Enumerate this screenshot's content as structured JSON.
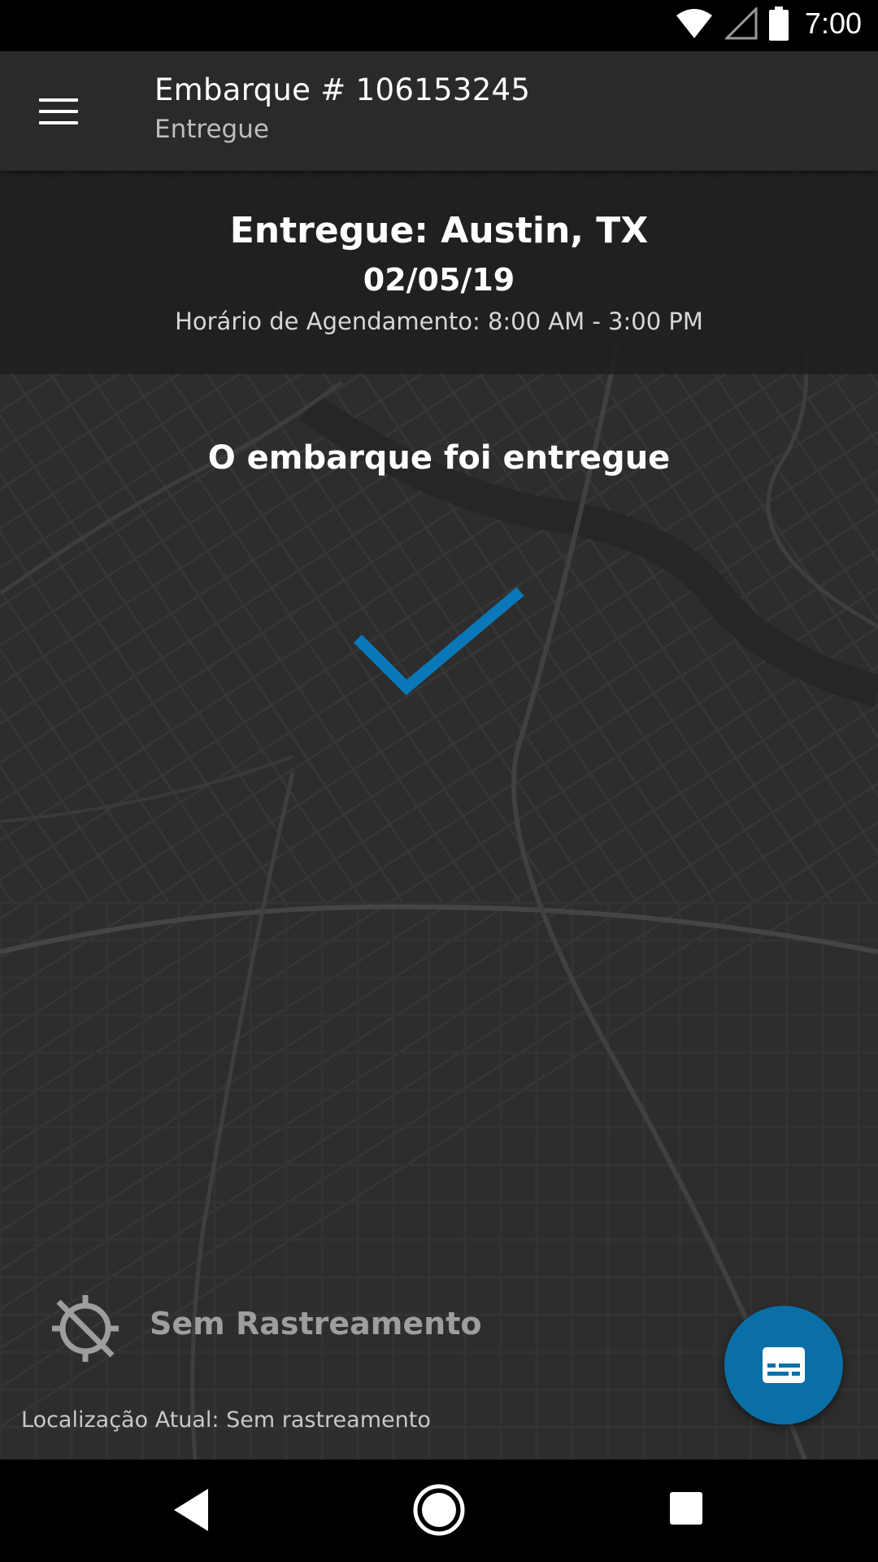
{
  "status_bar": {
    "time": "7:00",
    "icons": [
      "wifi-icon",
      "cell-signal-icon",
      "battery-icon"
    ]
  },
  "app_bar": {
    "menu_icon": "hamburger-menu-icon",
    "title": "Embarque # 106153245",
    "subtitle": "Entregue"
  },
  "info_panel": {
    "heading": "Entregue: Austin, TX",
    "date": "02/05/19",
    "schedule": "Horário de Agendamento: 8:00 AM - 3:00 PM"
  },
  "status_message": "O embarque foi entregue",
  "check_icon": "checkmark-icon",
  "check_color": "#0a78b8",
  "tracking": {
    "icon": "location-disabled-icon",
    "label": "Sem Rastreamento",
    "location_text": "Localização Atual: Sem rastreamento"
  },
  "fab": {
    "icon": "subtitles-icon",
    "color": "#0a6fa6"
  },
  "nav_bar": {
    "icons": [
      "back-icon",
      "home-icon",
      "recents-icon"
    ]
  }
}
